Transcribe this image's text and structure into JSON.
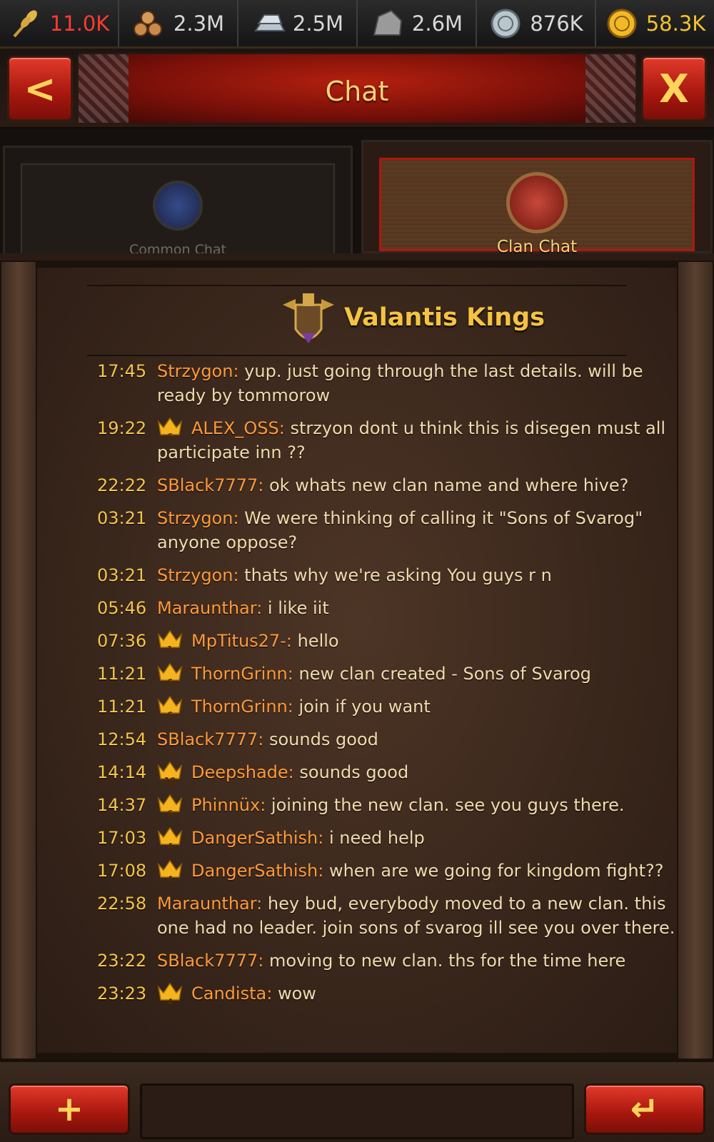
{
  "resources": [
    {
      "name": "food",
      "icon": "wheat-icon",
      "value": "11.0K",
      "low": true
    },
    {
      "name": "wood",
      "icon": "logs-icon",
      "value": "2.3M",
      "low": false
    },
    {
      "name": "iron",
      "icon": "ingot-icon",
      "value": "2.5M",
      "low": false
    },
    {
      "name": "stone",
      "icon": "stone-icon",
      "value": "2.6M",
      "low": false
    },
    {
      "name": "silver",
      "icon": "silver-coin-icon",
      "value": "876K",
      "low": false
    },
    {
      "name": "gold",
      "icon": "gold-coin-icon",
      "value": "58.3K",
      "low": false
    }
  ],
  "header": {
    "title": "Chat",
    "back_label": "<",
    "close_label": "X"
  },
  "tabs": {
    "common": {
      "label": "Common Chat",
      "active": false
    },
    "clan": {
      "label": "Clan Chat",
      "active": true
    }
  },
  "clan": {
    "name": "Valantis Kings"
  },
  "messages": [
    {
      "time": "17:45",
      "crown": null,
      "name": "Strzygon:",
      "text": "yup. just going through the last details. will be ready by tommorow"
    },
    {
      "time": "19:22",
      "crown": "6",
      "name": "ALEX_OSS:",
      "text": "strzyon dont u think this is disegen must all participate inn ??"
    },
    {
      "time": "22:22",
      "crown": null,
      "name": "SBlack7777:",
      "text": "ok whats new clan name and where hive?"
    },
    {
      "time": "03:21",
      "crown": null,
      "name": "Strzygon:",
      "text": "We were thinking of calling it \"Sons of Svarog\" anyone oppose?"
    },
    {
      "time": "03:21",
      "crown": null,
      "name": "Strzygon:",
      "text": "thats why we're asking You guys r n"
    },
    {
      "time": "05:46",
      "crown": null,
      "name": "Maraunthar:",
      "text": "i like iit"
    },
    {
      "time": "07:36",
      "crown": "1",
      "name": "MpTitus27-:",
      "text": "hello"
    },
    {
      "time": "11:21",
      "crown": "6",
      "name": "ThornGrinn:",
      "text": "new clan created - Sons of Svarog"
    },
    {
      "time": "11:21",
      "crown": "6",
      "name": "ThornGrinn:",
      "text": "join if you want"
    },
    {
      "time": "12:54",
      "crown": null,
      "name": "SBlack7777:",
      "text": "sounds good"
    },
    {
      "time": "14:14",
      "crown": "10",
      "name": "Deepshade:",
      "text": "sounds good"
    },
    {
      "time": "14:37",
      "crown": "6",
      "name": "Phinnüx:",
      "text": "joining the new clan. see you guys there."
    },
    {
      "time": "17:03",
      "crown": "4",
      "name": "DangerSathish:",
      "text": "i need help"
    },
    {
      "time": "17:08",
      "crown": "4",
      "name": "DangerSathish:",
      "text": "when are we going for kingdom fight??"
    },
    {
      "time": "22:58",
      "crown": null,
      "name": "Maraunthar:",
      "text": "hey bud, everybody moved to a new clan. this one had no leader. join sons of svarog ill see you over there."
    },
    {
      "time": "23:22",
      "crown": null,
      "name": "SBlack7777:",
      "text": "moving to new clan. ths for the time here"
    },
    {
      "time": "23:23",
      "crown": "4",
      "name": "Candista:",
      "text": "wow"
    }
  ],
  "composer": {
    "plus_label": "+",
    "send_label": "↵",
    "input_value": ""
  }
}
